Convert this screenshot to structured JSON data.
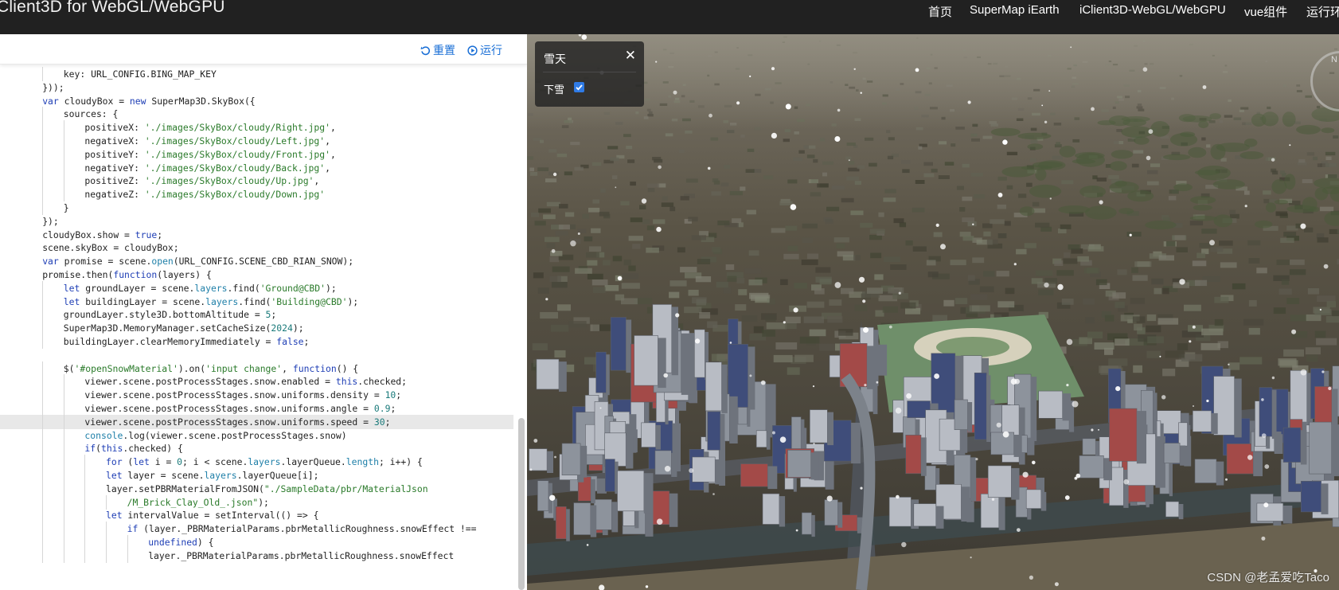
{
  "app": {
    "title": "Client3D for WebGL/WebGPU"
  },
  "nav": {
    "items": [
      {
        "label": "首页"
      },
      {
        "label": "SuperMap iEarth"
      },
      {
        "label": "iClient3D-WebGL/WebGPU"
      },
      {
        "label": "vue组件"
      },
      {
        "label": "运行环"
      }
    ]
  },
  "toolbar": {
    "reset_label": "重置",
    "run_label": "运行"
  },
  "editor": {
    "active_line": 26,
    "lines": [
      {
        "indent": 2,
        "tokens": [
          [
            "key: URL_CONFIG.BING_MAP_KEY",
            ""
          ]
        ]
      },
      {
        "indent": 1,
        "tokens": [
          [
            "}));",
            ""
          ]
        ]
      },
      {
        "indent": 1,
        "tokens": [
          [
            "var",
            "k"
          ],
          [
            " cloudyBox = ",
            ""
          ],
          [
            "new",
            "k"
          ],
          [
            " SuperMap3D.SkyBox({",
            ""
          ]
        ]
      },
      {
        "indent": 2,
        "tokens": [
          [
            "sources: {",
            ""
          ]
        ]
      },
      {
        "indent": 3,
        "tokens": [
          [
            "positiveX: ",
            ""
          ],
          [
            "'./images/SkyBox/cloudy/Right.jpg'",
            "s"
          ],
          [
            ",",
            ""
          ]
        ]
      },
      {
        "indent": 3,
        "tokens": [
          [
            "negativeX: ",
            ""
          ],
          [
            "'./images/SkyBox/cloudy/Left.jpg'",
            "s"
          ],
          [
            ",",
            ""
          ]
        ]
      },
      {
        "indent": 3,
        "tokens": [
          [
            "positiveY: ",
            ""
          ],
          [
            "'./images/SkyBox/cloudy/Front.jpg'",
            "s"
          ],
          [
            ",",
            ""
          ]
        ]
      },
      {
        "indent": 3,
        "tokens": [
          [
            "negativeY: ",
            ""
          ],
          [
            "'./images/SkyBox/cloudy/Back.jpg'",
            "s"
          ],
          [
            ",",
            ""
          ]
        ]
      },
      {
        "indent": 3,
        "tokens": [
          [
            "positiveZ: ",
            ""
          ],
          [
            "'./images/SkyBox/cloudy/Up.jpg'",
            "s"
          ],
          [
            ",",
            ""
          ]
        ]
      },
      {
        "indent": 3,
        "tokens": [
          [
            "negativeZ: ",
            ""
          ],
          [
            "'./images/SkyBox/cloudy/Down.jpg'",
            "s"
          ]
        ]
      },
      {
        "indent": 2,
        "tokens": [
          [
            "}",
            ""
          ]
        ]
      },
      {
        "indent": 1,
        "tokens": [
          [
            "});",
            ""
          ]
        ]
      },
      {
        "indent": 1,
        "tokens": [
          [
            "cloudyBox.show = ",
            ""
          ],
          [
            "true",
            "k"
          ],
          [
            ";",
            ""
          ]
        ]
      },
      {
        "indent": 1,
        "tokens": [
          [
            "scene.skyBox = cloudyBox;",
            ""
          ]
        ]
      },
      {
        "indent": 1,
        "tokens": [
          [
            "var",
            "k"
          ],
          [
            " promise = scene.",
            ""
          ],
          [
            "open",
            "p"
          ],
          [
            "(URL_CONFIG.SCENE_CBD_RIAN_SNOW);",
            ""
          ]
        ]
      },
      {
        "indent": 1,
        "tokens": [
          [
            "promise.then(",
            ""
          ],
          [
            "function",
            "k"
          ],
          [
            "(layers) {",
            ""
          ]
        ]
      },
      {
        "indent": 2,
        "tokens": [
          [
            "let",
            "k"
          ],
          [
            " groundLayer = scene.",
            ""
          ],
          [
            "layers",
            "p"
          ],
          [
            ".find(",
            ""
          ],
          [
            "'Ground@CBD'",
            "s"
          ],
          [
            ");",
            ""
          ]
        ]
      },
      {
        "indent": 2,
        "tokens": [
          [
            "let",
            "k"
          ],
          [
            " buildingLayer = scene.",
            ""
          ],
          [
            "layers",
            "p"
          ],
          [
            ".find(",
            ""
          ],
          [
            "'Building@CBD'",
            "s"
          ],
          [
            ");",
            ""
          ]
        ]
      },
      {
        "indent": 2,
        "tokens": [
          [
            "groundLayer.style3D.bottomAltitude = ",
            ""
          ],
          [
            "5",
            "n"
          ],
          [
            ";",
            ""
          ]
        ]
      },
      {
        "indent": 2,
        "tokens": [
          [
            "SuperMap3D.MemoryManager.setCacheSize(",
            ""
          ],
          [
            "2024",
            "n"
          ],
          [
            ");",
            ""
          ]
        ]
      },
      {
        "indent": 2,
        "tokens": [
          [
            "buildingLayer.clearMemoryImmediately = ",
            ""
          ],
          [
            "false",
            "k"
          ],
          [
            ";",
            ""
          ]
        ]
      },
      {
        "indent": 0,
        "tokens": []
      },
      {
        "indent": 2,
        "tokens": [
          [
            "$(",
            ""
          ],
          [
            "'#openSnowMaterial'",
            "s"
          ],
          [
            ").on(",
            ""
          ],
          [
            "'input change'",
            "s"
          ],
          [
            ", ",
            ""
          ],
          [
            "function",
            "k"
          ],
          [
            "() {",
            ""
          ]
        ]
      },
      {
        "indent": 3,
        "tokens": [
          [
            "viewer.scene.postProcessStages.snow.enabled = ",
            ""
          ],
          [
            "this",
            "k"
          ],
          [
            ".checked;",
            ""
          ]
        ]
      },
      {
        "indent": 3,
        "tokens": [
          [
            "viewer.scene.postProcessStages.snow.uniforms.density = ",
            ""
          ],
          [
            "10",
            "n"
          ],
          [
            ";",
            ""
          ]
        ]
      },
      {
        "indent": 3,
        "tokens": [
          [
            "viewer.scene.postProcessStages.snow.uniforms.angle = ",
            ""
          ],
          [
            "0.9",
            "n"
          ],
          [
            ";",
            ""
          ]
        ]
      },
      {
        "indent": 3,
        "tokens": [
          [
            "viewer.scene.postProcessStages.snow.uniforms.speed = ",
            ""
          ],
          [
            "30",
            "n"
          ],
          [
            ";",
            ""
          ]
        ]
      },
      {
        "indent": 3,
        "tokens": [
          [
            "console",
            "p"
          ],
          [
            ".log(viewer.scene.postProcessStages.snow)",
            ""
          ]
        ]
      },
      {
        "indent": 3,
        "tokens": [
          [
            "if",
            "k"
          ],
          [
            "(",
            ""
          ],
          [
            "this",
            "k"
          ],
          [
            ".checked) {",
            ""
          ]
        ]
      },
      {
        "indent": 4,
        "tokens": [
          [
            "for",
            "k"
          ],
          [
            " (",
            ""
          ],
          [
            "let",
            "k"
          ],
          [
            " i = ",
            ""
          ],
          [
            "0",
            "n"
          ],
          [
            "; i < scene.",
            ""
          ],
          [
            "layers",
            "p"
          ],
          [
            ".layerQueue.",
            ""
          ],
          [
            "length",
            "p"
          ],
          [
            "; i++) {",
            ""
          ]
        ]
      },
      {
        "indent": 4,
        "tokens": [
          [
            "let",
            "k"
          ],
          [
            " layer = scene.",
            ""
          ],
          [
            "layers",
            "p"
          ],
          [
            ".layerQueue[i];",
            ""
          ]
        ]
      },
      {
        "indent": 4,
        "tokens": [
          [
            "layer.setPBRMaterialFromJSON(",
            ""
          ],
          [
            "\"./SampleData/pbr/MaterialJson",
            "s"
          ]
        ]
      },
      {
        "indent": 5,
        "tokens": [
          [
            "/M_Brick_Clay_Old_.json\"",
            "s"
          ],
          [
            ");",
            ""
          ]
        ]
      },
      {
        "indent": 4,
        "tokens": [
          [
            "let",
            "k"
          ],
          [
            " intervalValue = setInterval(() => {",
            ""
          ]
        ]
      },
      {
        "indent": 5,
        "tokens": [
          [
            "if",
            "k"
          ],
          [
            " (layer._PBRMaterialParams.pbrMetallicRoughness.snowEffect !==",
            ""
          ]
        ]
      },
      {
        "indent": 6,
        "tokens": [
          [
            "undefined",
            "k"
          ],
          [
            ") {",
            ""
          ]
        ]
      },
      {
        "indent": 6,
        "tokens": [
          [
            "layer._PBRMaterialParams.pbrMetallicRoughness.snowEffect",
            ""
          ]
        ]
      }
    ]
  },
  "snow_panel": {
    "title": "雪天",
    "close_icon": "close-icon",
    "checkbox_label": "下雪",
    "checked": true
  },
  "compass": {
    "label": "N"
  },
  "watermark": "CSDN @老孟爱吃Taco",
  "colors": {
    "topbar": "#212121",
    "accent": "#1a6fd6",
    "keyword": "#1e3eb5",
    "string": "#2a7a2a",
    "number": "#1a7a7a"
  }
}
